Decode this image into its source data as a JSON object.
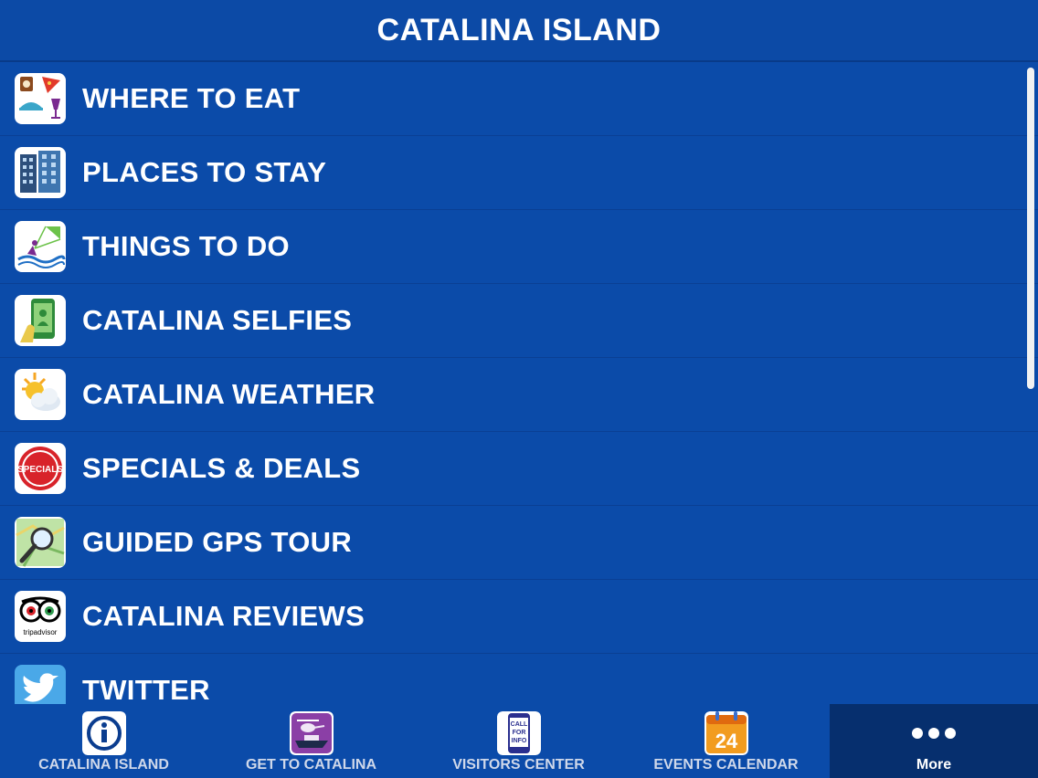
{
  "header": {
    "title": "CATALINA ISLAND"
  },
  "menu": {
    "items": [
      {
        "label": "WHERE TO EAT",
        "icon": "food-drink-icon"
      },
      {
        "label": "PLACES TO STAY",
        "icon": "hotel-icon"
      },
      {
        "label": "THINGS TO DO",
        "icon": "kitesurf-icon"
      },
      {
        "label": "CATALINA SELFIES",
        "icon": "selfie-phone-icon"
      },
      {
        "label": "CATALINA WEATHER",
        "icon": "weather-sun-cloud-icon"
      },
      {
        "label": "SPECIALS & DEALS",
        "icon": "specials-badge-icon"
      },
      {
        "label": "GUIDED GPS TOUR",
        "icon": "map-magnifier-icon"
      },
      {
        "label": "CATALINA REVIEWS",
        "icon": "tripadvisor-icon"
      },
      {
        "label": "TWITTER",
        "icon": "twitter-bird-icon"
      }
    ]
  },
  "icon_text": {
    "specials": "SPECIALS",
    "tripadvisor": "tripadvisor",
    "call_for_info": [
      "CALL",
      "FOR",
      "INFO"
    ],
    "calendar_day": "24"
  },
  "tabbar": {
    "tabs": [
      {
        "label": "CATALINA ISLAND",
        "icon": "info-icon"
      },
      {
        "label": "GET TO CATALINA",
        "icon": "helicopter-boat-icon"
      },
      {
        "label": "VISITORS CENTER",
        "icon": "call-for-info-icon"
      },
      {
        "label": "EVENTS CALENDAR",
        "icon": "calendar-icon"
      },
      {
        "label": "More",
        "icon": "more-dots-icon",
        "active": true
      }
    ]
  },
  "colors": {
    "background": "#0b4ba9",
    "active_tab": "#062f6e",
    "text": "#ffffff"
  }
}
